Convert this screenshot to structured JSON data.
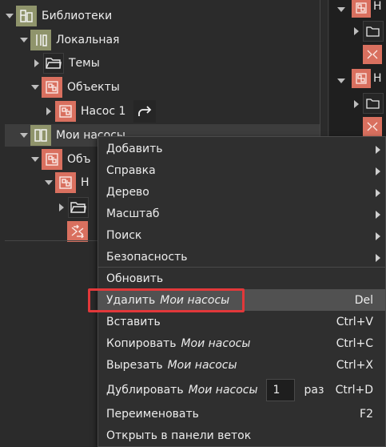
{
  "tree": {
    "libraries_label": "Библиотеки",
    "local_label": "Локальная",
    "themes_label": "Темы",
    "objects_label": "Объекты",
    "pump1_label": "Насос 1",
    "my_pumps_label": "Мои насосы",
    "my_objects_partial": "Объ",
    "my_pump_partial": "Н"
  },
  "context_menu": {
    "items": [
      {
        "label": "Добавить",
        "submenu": true
      },
      {
        "label": "Справка",
        "submenu": true
      },
      {
        "label": "Дерево",
        "submenu": true
      },
      {
        "label": "Масштаб",
        "submenu": true
      },
      {
        "label": "Поиск",
        "submenu": true
      },
      {
        "label": "Безопасность",
        "submenu": true
      },
      {
        "label": "Обновить"
      },
      {
        "label": "Удалить",
        "target": "Мои насосы",
        "shortcut": "Del"
      },
      {
        "label": "Вставить",
        "shortcut": "Ctrl+V"
      },
      {
        "label": "Копировать",
        "target": "Мои насосы",
        "shortcut": "Ctrl+C"
      },
      {
        "label": "Вырезать",
        "target": "Мои насосы",
        "shortcut": "Ctrl+X"
      },
      {
        "label": "Дублировать",
        "target": "Мои насосы",
        "count": "1",
        "count_suffix": "раз",
        "shortcut": "Ctrl+D"
      },
      {
        "label": "Переименовать",
        "shortcut": "F2"
      },
      {
        "label": "Открыть в панели веток"
      }
    ]
  },
  "right_panel": {
    "row1_partial": "Н",
    "row2_partial": "Н"
  },
  "colors": {
    "library_icon": "#8f946b",
    "object_icon": "#d9705f",
    "highlight_border": "#e2383a",
    "menu_bg": "#2f2f2f"
  }
}
